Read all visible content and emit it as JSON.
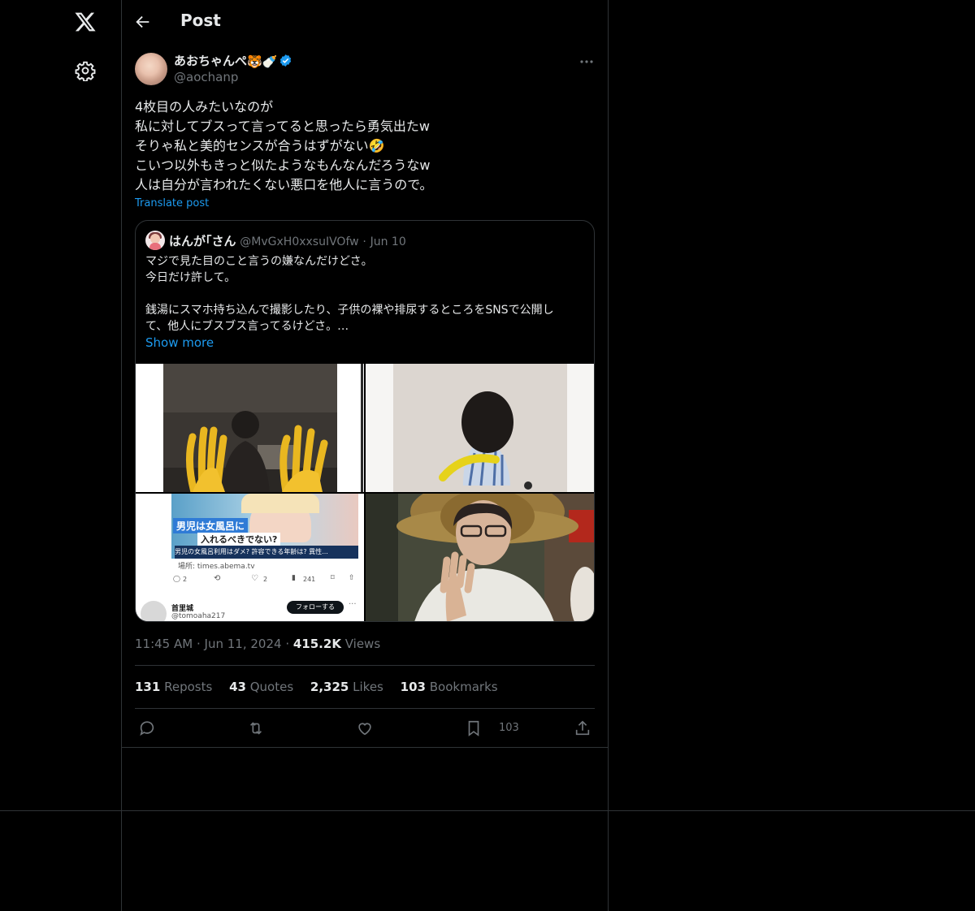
{
  "nav": {
    "logo_icon": "x-logo-icon",
    "settings_icon": "gear-icon"
  },
  "header": {
    "title": "Post",
    "back_icon": "arrow-left-icon"
  },
  "post": {
    "author_name": "あおちゃんぺ",
    "author_emojis": "🐯🍼",
    "author_handle": "@aochanp",
    "verified": true,
    "text_lines": [
      "4枚目の人みたいなのが",
      "私に対してブスって言ってると思ったら勇気出たw",
      "そりゃ私と美的センスが合うはずがない🤣",
      "こいつ以外もきっと似たようなもんなんだろうなw",
      "人は自分が言われたくない悪口を他人に言うので。"
    ],
    "translate_label": "Translate post",
    "time": "11:45 AM",
    "date": "Jun 11, 2024",
    "views_count": "415.2K",
    "views_label": "Views"
  },
  "quote": {
    "name": "はんが｢さん",
    "handle": "@MvGxH0xxsuIVOfw",
    "date": "Jun 10",
    "lines": [
      "マジで見た目のこと言うの嫌なんだけどさ。",
      "今日だけ許して。",
      "",
      "銭湯にスマホ持ち込んで撮影したり、子供の裸や排尿するところをSNSで公開し",
      "て、他人にブスブス言ってるけどさ。…"
    ],
    "show_more": "Show more",
    "screenshot": {
      "caption_1": "男児は女風呂に",
      "caption_2": "入れるべきでない?",
      "ticker": "男児の女風呂利用はダメ? 許容できる年齢は? 異性...",
      "source": "場所: times.abema.tv",
      "reply_count": "2",
      "like_count": "2",
      "view_count": "241",
      "user_name": "首里城",
      "user_handle": "@tomoaha217",
      "follow_label": "フォローする"
    }
  },
  "stats": {
    "reposts_count": "131",
    "reposts_label": "Reposts",
    "quotes_count": "43",
    "quotes_label": "Quotes",
    "likes_count": "2,325",
    "likes_label": "Likes",
    "bookmarks_count": "103",
    "bookmarks_label": "Bookmarks"
  },
  "actions": {
    "bookmark_count": "103"
  },
  "colors": {
    "background": "#000000",
    "text": "#e7e9ea",
    "muted": "#71767b",
    "accent": "#1d9bf0",
    "border": "#2f3336"
  }
}
